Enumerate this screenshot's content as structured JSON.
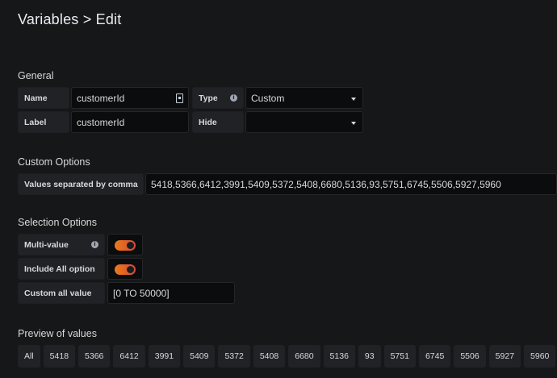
{
  "header": {
    "title": "Variables > Edit"
  },
  "general": {
    "section_title": "General",
    "name_label": "Name",
    "name_value": "customerId",
    "type_label": "Type",
    "type_value": "Custom",
    "label_label": "Label",
    "label_value": "customerId",
    "hide_label": "Hide",
    "hide_value": ""
  },
  "custom_options": {
    "section_title": "Custom Options",
    "values_label": "Values separated by comma",
    "values_value": "5418,5366,6412,3991,5409,5372,5408,6680,5136,93,5751,6745,5506,5927,5960"
  },
  "selection_options": {
    "section_title": "Selection Options",
    "multi_value_label": "Multi-value",
    "multi_value_on": true,
    "include_all_label": "Include All option",
    "include_all_on": true,
    "custom_all_label": "Custom all value",
    "custom_all_value": "[0 TO 50000]"
  },
  "preview": {
    "section_title": "Preview of values",
    "values": [
      "All",
      "5418",
      "5366",
      "6412",
      "3991",
      "5409",
      "5372",
      "5408",
      "6680",
      "5136",
      "93",
      "5751",
      "6745",
      "5506",
      "5927",
      "5960"
    ]
  },
  "colors": {
    "background": "#161719",
    "label_bg": "#212226",
    "input_bg": "#0b0c0e",
    "switch_on_start": "#eb7b18",
    "switch_on_end": "#d44a3a"
  },
  "icons": {
    "name_field": "id-card-icon",
    "info": "info-circle-icon",
    "dropdown": "caret-down-icon"
  }
}
